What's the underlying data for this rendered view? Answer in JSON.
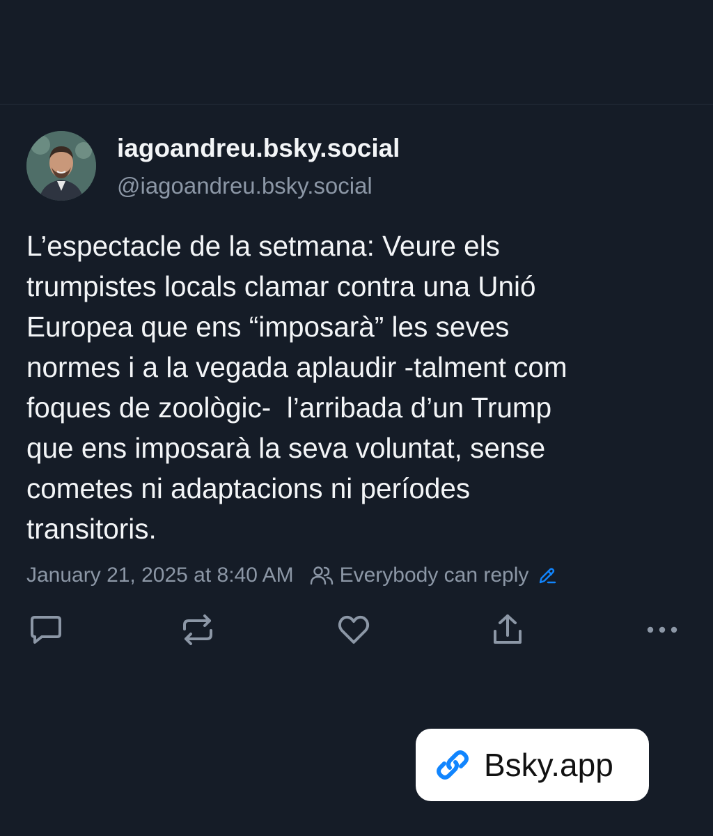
{
  "post": {
    "display_name": "iagoandreu.bsky.social",
    "handle": "@iagoandreu.bsky.social",
    "text_lines": [
      "L’espectacle de la setmana: Veure els",
      "trumpistes locals clamar contra una Unió",
      "Europea que ens “imposarà” les seves",
      "normes i a la vegada aplaudir -talment com",
      "foques de zoològic-  l’arribada d’un Trump",
      "que ens imposarà la seva voluntat, sense",
      "cometes ni adaptacions ni períodes",
      "transitoris."
    ],
    "timestamp": "January 21, 2025 at 8:40 AM",
    "reply_setting": "Everybody can reply"
  },
  "actions": {
    "reply_icon": "speech-bubble-icon",
    "repost_icon": "repost-arrows-icon",
    "like_icon": "heart-icon",
    "share_icon": "share-upload-icon",
    "more_icon": "ellipsis-icon"
  },
  "badge": {
    "label": "Bsky.app",
    "icon": "link-icon"
  },
  "colors": {
    "background": "#151c27",
    "text_primary": "#f3f5f7",
    "text_secondary": "#8c97a6",
    "accent": "#1185fe",
    "badge_background": "#ffffff"
  }
}
